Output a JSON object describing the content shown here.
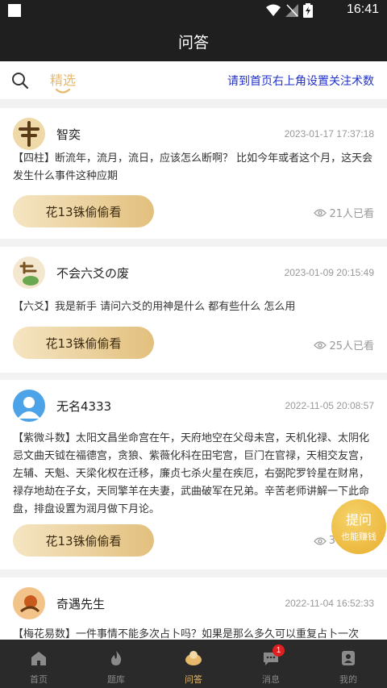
{
  "status_bar": {
    "time": "16:41"
  },
  "header": {
    "title": "问答"
  },
  "subbar": {
    "tab_label": "精选",
    "notice": "请到首页右上角设置关注术数"
  },
  "posts": [
    {
      "user": "智奕",
      "time": "2023-01-17 17:37:18",
      "text": "【四柱】断流年，流月，流日，应该怎么断啊？ 比如今年或者这个月，这天会发生什么事件这种应期",
      "peek_label": "花13铢偷偷看",
      "views": "21人已看"
    },
    {
      "user": "不会六爻の废",
      "time": "2023-01-09 20:15:49",
      "text": "【六爻】我是新手 请问六爻的用神是什么 都有些什么 怎么用",
      "peek_label": "花13铢偷偷看",
      "views": "25人已看"
    },
    {
      "user": "无名4333",
      "time": "2022-11-05 20:08:57",
      "text": "【紫微斗数】太阳文昌坐命宫在午，天府地空在父母未宫，天机化禄、太阴化忌文曲天钺在福德宫，贪狼、紫薇化科在田宅宫，巨门在官禄，天相交友宫，左辅、天魁、天梁化权在迁移，廉贞七杀火星在疾厄，右弼陀罗铃星在财帛，禄存地劫在子女，天同擎羊在夫妻，武曲破军在兄弟。辛苦老师讲解一下此命盘，排盘设置为润月做下月论。",
      "peek_label": "花13铢偷偷看",
      "views": "3"
    },
    {
      "user": "奇遇先生",
      "time": "2022-11-04 16:52:33",
      "text": "【梅花易数】一件事情不能多次占卜吗？如果是那么多久可以重复占卜一次"
    }
  ],
  "float_button": {
    "line1": "提问",
    "line2": "也能赚钱"
  },
  "bottom_nav": [
    {
      "label": "首页",
      "icon": "home-icon"
    },
    {
      "label": "题库",
      "icon": "flame-icon"
    },
    {
      "label": "问答",
      "icon": "qa-icon"
    },
    {
      "label": "消息",
      "icon": "message-icon"
    },
    {
      "label": "我的",
      "icon": "user-icon"
    }
  ],
  "message_badge": "1",
  "colors": {
    "accent": "#e7b96b",
    "notice": "#2032c8",
    "bar": "#1f1f1f",
    "nav": "#2a2a2a"
  }
}
